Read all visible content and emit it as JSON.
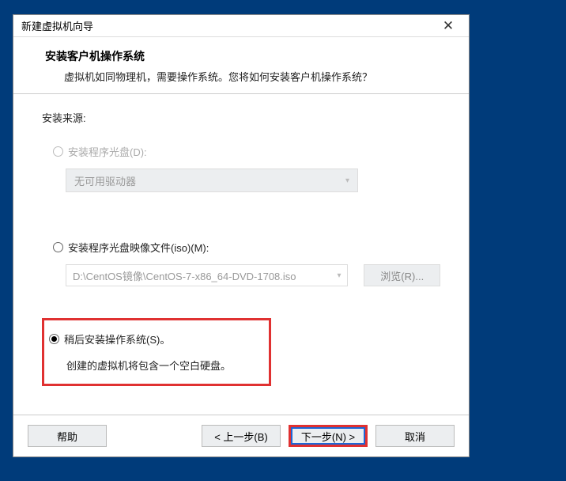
{
  "window": {
    "title": "新建虚拟机向导"
  },
  "header": {
    "heading": "安装客户机操作系统",
    "subtext": "虚拟机如同物理机，需要操作系统。您将如何安装客户机操作系统？"
  },
  "source": {
    "label": "安装来源:",
    "opt_disc": {
      "label": "安装程序光盘(D):",
      "dropdown": "无可用驱动器"
    },
    "opt_iso": {
      "label": "安装程序光盘映像文件(iso)(M):",
      "path": "D:\\CentOS镜像\\CentOS-7-x86_64-DVD-1708.iso",
      "browse": "浏览(R)..."
    },
    "opt_later": {
      "label": "稍后安装操作系统(S)。",
      "desc": "创建的虚拟机将包含一个空白硬盘。"
    }
  },
  "footer": {
    "help": "帮助",
    "back": "< 上一步(B)",
    "next": "下一步(N) >",
    "cancel": "取消"
  }
}
